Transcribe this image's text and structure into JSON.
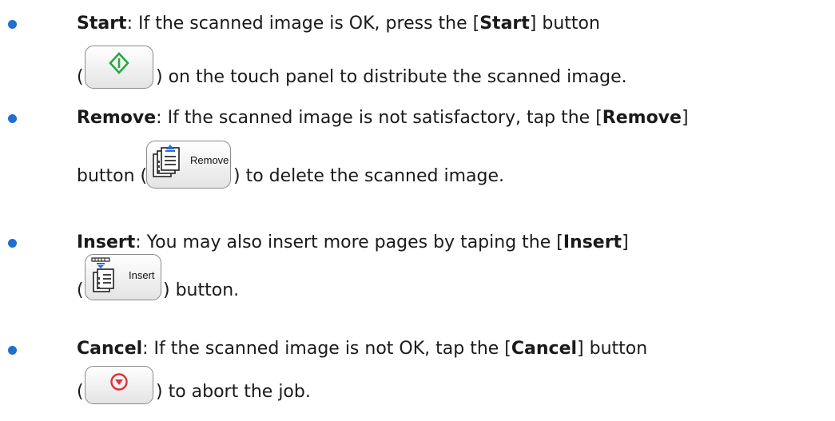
{
  "items": [
    {
      "term": "Start",
      "line1": {
        "pre": ": If the scanned image is OK, press the [",
        "bold": "Start",
        "post": "] button"
      },
      "line2": {
        "open": "(",
        "post": ") on the touch panel to distribute the scanned image."
      }
    },
    {
      "term": "Remove",
      "line1": {
        "pre": ": If the scanned image is not satisfactory, tap the [",
        "bold": "Remove",
        "post": "]"
      },
      "line2": {
        "pre": "button (",
        "post": ") to delete the scanned image."
      },
      "button_label": "Remove"
    },
    {
      "term": "Insert",
      "line1": {
        "pre": ": You may also insert more pages by taping the [",
        "bold": "Insert",
        "post": "]"
      },
      "line2": {
        "open": "(",
        "post": ") button."
      },
      "button_label": "Insert"
    },
    {
      "term": "Cancel",
      "line1": {
        "pre": ": If the scanned image is not OK, tap the [",
        "bold": "Cancel",
        "post": "] button"
      },
      "line2": {
        "open": "(",
        "post": ") to abort the job."
      }
    }
  ],
  "icons": {
    "start": "start-diamond-icon",
    "remove": "remove-pages-icon",
    "insert": "insert-pages-icon",
    "cancel": "cancel-circle-icon"
  },
  "colors": {
    "bullet": "#1f6fd1",
    "start_icon": "#27a844",
    "cancel_icon": "#e0303a"
  }
}
